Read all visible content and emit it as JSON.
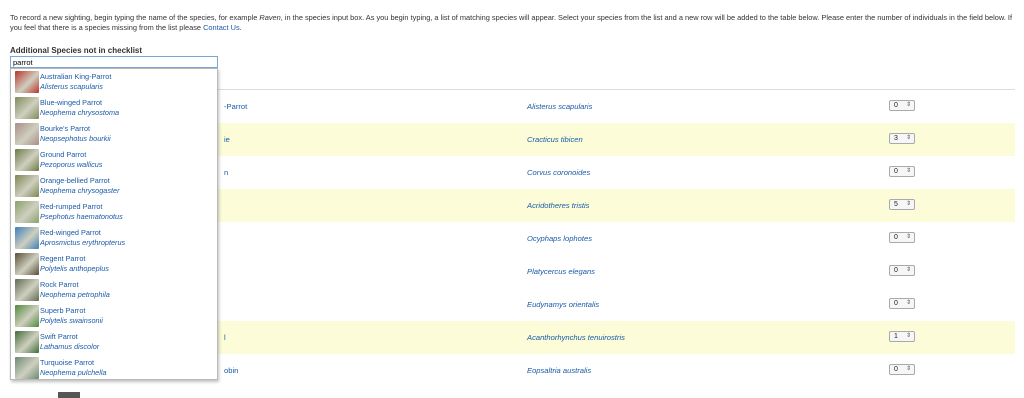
{
  "intro": {
    "text_before_example": "To record a new sighting, begin typing the name of the species, for example ",
    "example_word": "Raven",
    "text_after_example": ", in the species input box. As you begin typing, a list of matching species will appear. Select your species from the list and a new row will be added to the table below. Please enter the number of individuals in the field below. If you feel that there is a species missing from the list please ",
    "contact_link": "Contact Us",
    "text_end": "."
  },
  "additional_species": {
    "label": "Additional Species not in checklist",
    "value": "parrot"
  },
  "table": {
    "rows": [
      {
        "common": "-Parrot",
        "scientific": "Alisterus scapularis",
        "count": "0"
      },
      {
        "common": "ie",
        "scientific": "Cracticus tibicen",
        "count": "3"
      },
      {
        "common": "n",
        "scientific": "Corvus coronoides",
        "count": "0"
      },
      {
        "common": "",
        "scientific": "Acridotheres tristis",
        "count": "5"
      },
      {
        "common": "",
        "scientific": "Ocyphaps lophotes",
        "count": "0"
      },
      {
        "common": "",
        "scientific": "Platycercus elegans",
        "count": "0"
      },
      {
        "common": "",
        "scientific": "Eudynamys orientalis",
        "count": "0"
      },
      {
        "common": "l",
        "scientific": "Acanthorhynchus tenuirostris",
        "count": "1"
      },
      {
        "common": "obin",
        "scientific": "Eopsaltria australis",
        "count": "0"
      }
    ]
  },
  "dropdown": {
    "items": [
      {
        "name": "Australian King-Parrot",
        "scientific": "Alisterus scapularis",
        "thumb_color": "#b8342a"
      },
      {
        "name": "Blue-winged Parrot",
        "scientific": "Neophema chrysostoma",
        "thumb_color": "#7f8a5a"
      },
      {
        "name": "Bourke's Parrot",
        "scientific": "Neopsephotus bourkii",
        "thumb_color": "#a98d86"
      },
      {
        "name": "Ground Parrot",
        "scientific": "Pezoporus wallicus",
        "thumb_color": "#6d7a45"
      },
      {
        "name": "Orange-bellied Parrot",
        "scientific": "Neophema chrysogaster",
        "thumb_color": "#7c8752"
      },
      {
        "name": "Red-rumped Parrot",
        "scientific": "Psephotus haematonotus",
        "thumb_color": "#8aa06a"
      },
      {
        "name": "Red-winged Parrot",
        "scientific": "Aprosmictus erythropterus",
        "thumb_color": "#3d7fb8"
      },
      {
        "name": "Regent Parrot",
        "scientific": "Polytelis anthopeplus",
        "thumb_color": "#5a4f38"
      },
      {
        "name": "Rock Parrot",
        "scientific": "Neophema petrophila",
        "thumb_color": "#5f6a52"
      },
      {
        "name": "Superb Parrot",
        "scientific": "Polytelis swainsonii",
        "thumb_color": "#4f8a3c"
      },
      {
        "name": "Swift Parrot",
        "scientific": "Lathamus discolor",
        "thumb_color": "#3f6d3a"
      },
      {
        "name": "Turquoise Parrot",
        "scientific": "Neophema pulchella",
        "thumb_color": "#6a8a72"
      }
    ]
  },
  "colors": {
    "link": "#1a5aa8",
    "row_highlight": "#fcfcd8"
  }
}
